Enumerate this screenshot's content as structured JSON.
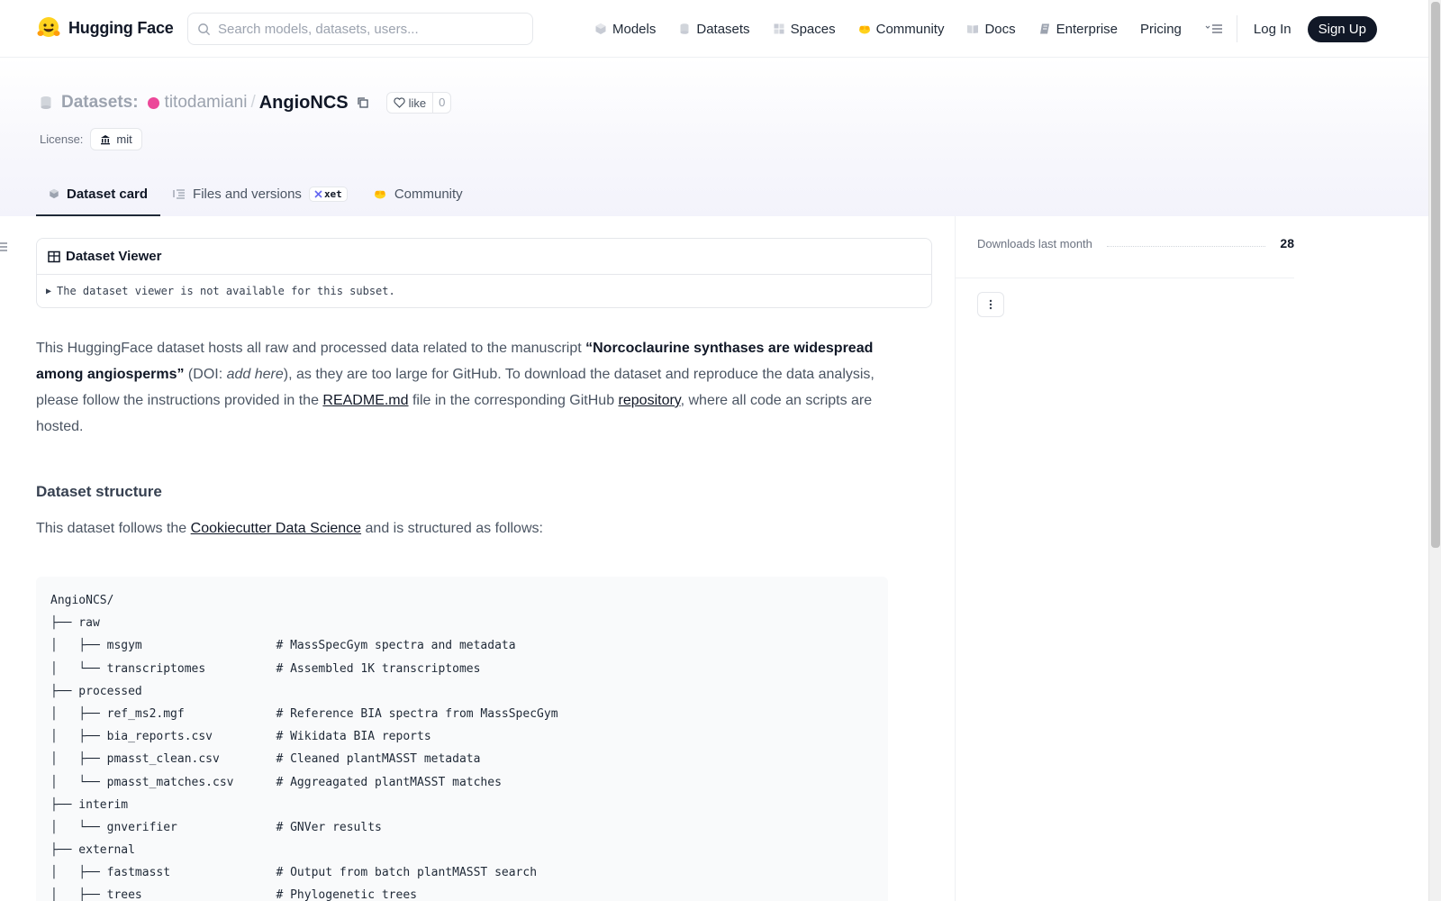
{
  "navbar": {
    "brand": "Hugging Face",
    "search_placeholder": "Search models, datasets, users...",
    "links": [
      "Models",
      "Datasets",
      "Spaces",
      "Community",
      "Docs",
      "Enterprise",
      "Pricing"
    ],
    "login": "Log In",
    "signup": "Sign Up"
  },
  "header": {
    "section_label": "Datasets:",
    "owner": "titodamiani",
    "separator": "/",
    "repo": "AngioNCS",
    "like_label": "like",
    "like_count": "0",
    "license_label": "License:",
    "license_value": "mit"
  },
  "tabs": [
    {
      "label": "Dataset card",
      "active": true
    },
    {
      "label": "Files and versions",
      "badge": "xet"
    },
    {
      "label": "Community"
    }
  ],
  "viewer": {
    "title": "Dataset Viewer",
    "message": "The dataset viewer is not available for this subset."
  },
  "content": {
    "intro_1": "This HuggingFace dataset hosts all raw and processed data related to the manuscript ",
    "manuscript_title": "“Norcoclaurine synthases are widespread among angiosperms”",
    "intro_2": " (DOI: ",
    "doi": "add here",
    "intro_3": "), as they are too large for GitHub. To download the dataset and reproduce the data analysis, please follow the instructions provided in the ",
    "readme_link": "README.md",
    "intro_4": " file in the corresponding GitHub ",
    "repo_link": "repository",
    "intro_5": ", where all code an scripts are hosted.",
    "structure_heading": "Dataset structure",
    "structure_1": "This dataset follows the ",
    "cookiecutter_link": "Cookiecutter Data Science",
    "structure_2": " and is structured as follows:",
    "code_lines": [
      "AngioNCS/",
      "├── raw",
      "│   ├── msgym                   # MassSpecGym spectra and metadata",
      "│   └── transcriptomes          # Assembled 1K transcriptomes",
      "├── processed",
      "│   ├── ref_ms2.mgf             # Reference BIA spectra from MassSpecGym",
      "│   ├── bia_reports.csv         # Wikidata BIA reports",
      "│   ├── pmasst_clean.csv        # Cleaned plantMASST metadata",
      "│   └── pmasst_matches.csv      # Aggreagated plantMASST matches",
      "├── interim",
      "│   └── gnverifier              # GNVer results",
      "├── external",
      "│   ├── fastmasst               # Output from batch plantMASST search",
      "│   ├── trees                   # Phylogenetic trees"
    ]
  },
  "sidebar": {
    "downloads_label": "Downloads last month",
    "downloads_value": "28"
  }
}
